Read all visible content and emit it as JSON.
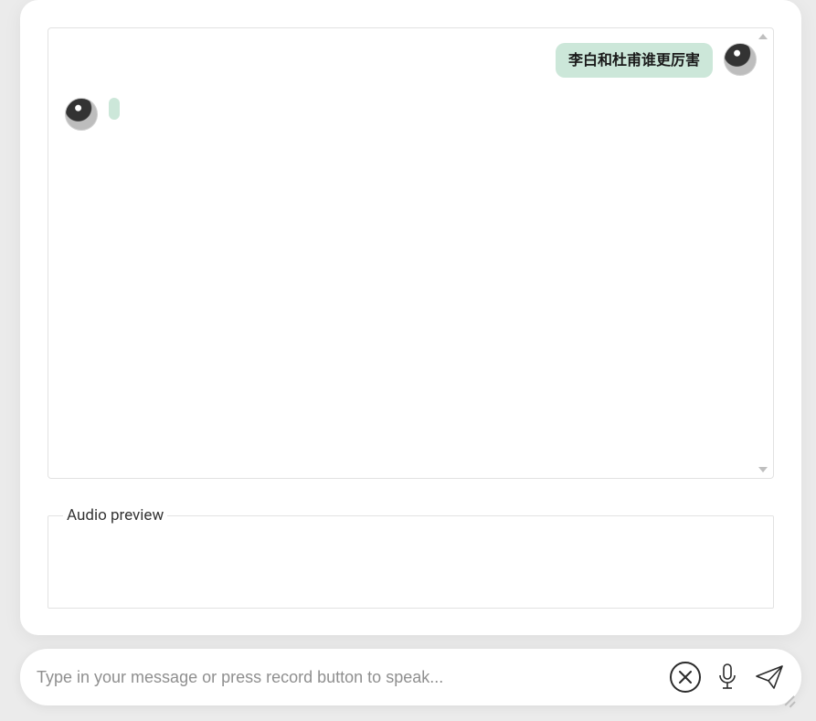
{
  "chat": {
    "messages": [
      {
        "role": "user",
        "text": "李白和杜甫谁更厉害"
      },
      {
        "role": "assistant",
        "text": ""
      }
    ]
  },
  "audio_preview": {
    "legend": "Audio preview"
  },
  "input": {
    "placeholder": "Type in your message or press record button to speak...",
    "value": ""
  },
  "icons": {
    "cancel": "close-icon",
    "mic": "microphone-icon",
    "send": "paper-plane-icon"
  }
}
